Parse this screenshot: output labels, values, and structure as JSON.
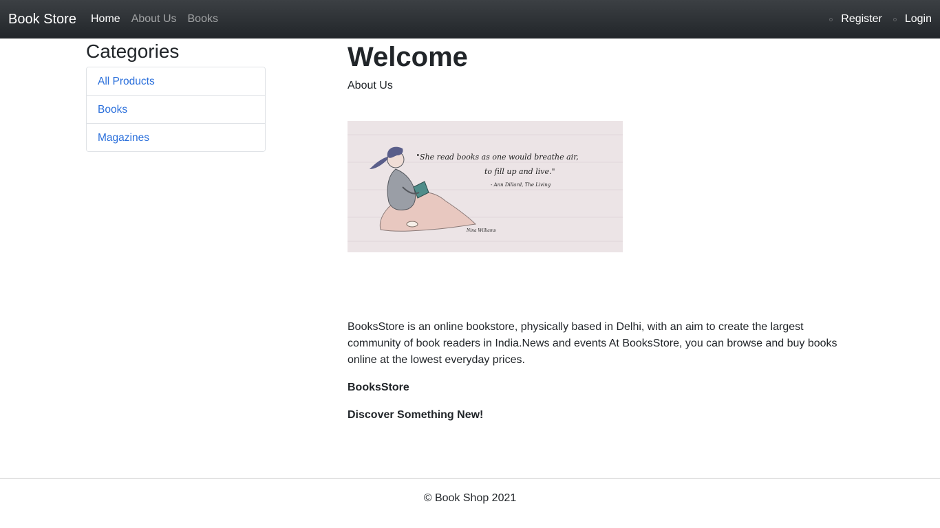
{
  "navbar": {
    "brand": "Book Store",
    "links": [
      {
        "label": "Home",
        "active": true
      },
      {
        "label": "About Us",
        "active": false
      },
      {
        "label": "Books",
        "active": false
      }
    ],
    "right_links": [
      {
        "label": "Register",
        "icon": "dot-icon"
      },
      {
        "label": "Login",
        "icon": "dot-icon"
      }
    ]
  },
  "sidebar": {
    "title": "Categories",
    "items": [
      {
        "label": "All Products"
      },
      {
        "label": "Books"
      },
      {
        "label": "Magazines"
      }
    ]
  },
  "main": {
    "heading": "Welcome",
    "about_link": "About Us",
    "hero": {
      "quote_line1": "\"She read books as one would breathe air,",
      "quote_line2": "to fill up and live.\"",
      "attribution": "- Ann Dillard, The Living",
      "signature": "Nina Williams"
    },
    "paragraph": "BooksStore is an online bookstore, physically based in Delhi, with an aim to create the largest community of book readers in India.News and events At BooksStore, you can browse and buy books online at the lowest everyday prices.",
    "bold_line1": "BooksStore",
    "bold_line2": "Discover Something New!"
  },
  "footer": {
    "text": "© Book Shop 2021"
  },
  "colors": {
    "navbar_bg": "#212529",
    "link_blue": "#2a6fdb",
    "text": "#212529"
  }
}
